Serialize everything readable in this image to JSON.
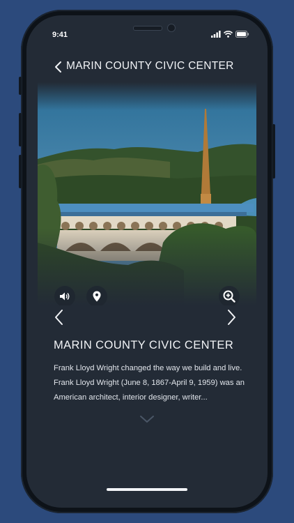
{
  "status": {
    "time": "9:41"
  },
  "header": {
    "back_icon": "chevron-left-icon",
    "title": "MARIN COUNTY CIVIC CENTER"
  },
  "photo": {
    "subject": "Marin County Civic Center",
    "buttons": {
      "audio_icon": "speaker-icon",
      "location_icon": "map-pin-icon",
      "zoom_icon": "zoom-in-icon"
    }
  },
  "navigation": {
    "prev_icon": "chevron-left-icon",
    "next_icon": "chevron-right-icon"
  },
  "detail": {
    "title": "MARIN COUNTY CIVIC CENTER",
    "description": "Frank Lloyd Wright changed the way we build and live. Frank Lloyd Wright (June 8, 1867-April 9, 1959) was an American architect, interior designer, writer...",
    "expand_icon": "chevron-down-icon"
  },
  "colors": {
    "background": "#2c4a7c",
    "screen": "#232b36",
    "text": "#f2f4f7"
  }
}
